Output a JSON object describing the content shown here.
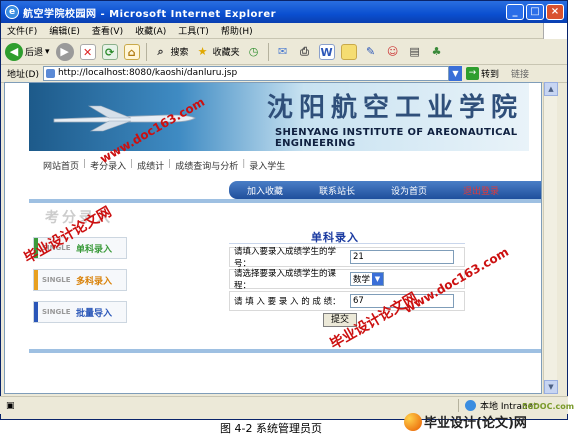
{
  "window": {
    "title": "航空学院校园网 - Microsoft Internet Explorer",
    "minimize": "_",
    "maximize": "□",
    "close": "×"
  },
  "menu": [
    "文件(F)",
    "编辑(E)",
    "查看(V)",
    "收藏(A)",
    "工具(T)",
    "帮助(H)"
  ],
  "toolbar": {
    "back": "后退",
    "search": "搜索",
    "favorites": "收藏夹"
  },
  "address": {
    "label": "地址(D)",
    "url": "http://localhost:8080/kaoshi/danluru.jsp",
    "go": "转到",
    "links": "链接"
  },
  "banner": {
    "school_cn": "沈阳航空工业学院",
    "school_en": "SHENYANG INSTITUTE OF AREONAUTICAL ENGINEERING"
  },
  "nav": [
    "网站首页",
    "考分录入",
    "成绩计",
    "成绩查询与分析",
    "录入学生"
  ],
  "topnav": [
    "加入收藏",
    "联系站长",
    "设为首页",
    "退出登录"
  ],
  "sidebar": {
    "title": "考分录入",
    "items": [
      {
        "label": "单科录入",
        "thumb": "SINGLE"
      },
      {
        "label": "多科录入",
        "thumb": "SINGLE"
      },
      {
        "label": "批量导入",
        "thumb": "SINGLE"
      }
    ]
  },
  "form": {
    "title": "单科录入",
    "student_label": "请填入要录入成绩学生的学号：",
    "student_value": "21",
    "course_label": "请选择要录入成绩学生的课程：",
    "course_value": "数学",
    "score_label": "请 填 入 要 录 入 的 成 绩：",
    "score_value": "67",
    "submit": "提交"
  },
  "status": {
    "zone": "本地 Intranet"
  },
  "caption": "图 4-2 系统管理员页",
  "watermarks": {
    "site": "www.doc163.com",
    "site2": "www.doc163.com",
    "label": "毕业设计论文网",
    "label2": "毕业设计论文网",
    "brand": "毕业设计(论文)网",
    "brand_site": "56DOC.com"
  },
  "colors": {
    "accent": "#1f4f9c",
    "watermark": "#cc1010"
  }
}
